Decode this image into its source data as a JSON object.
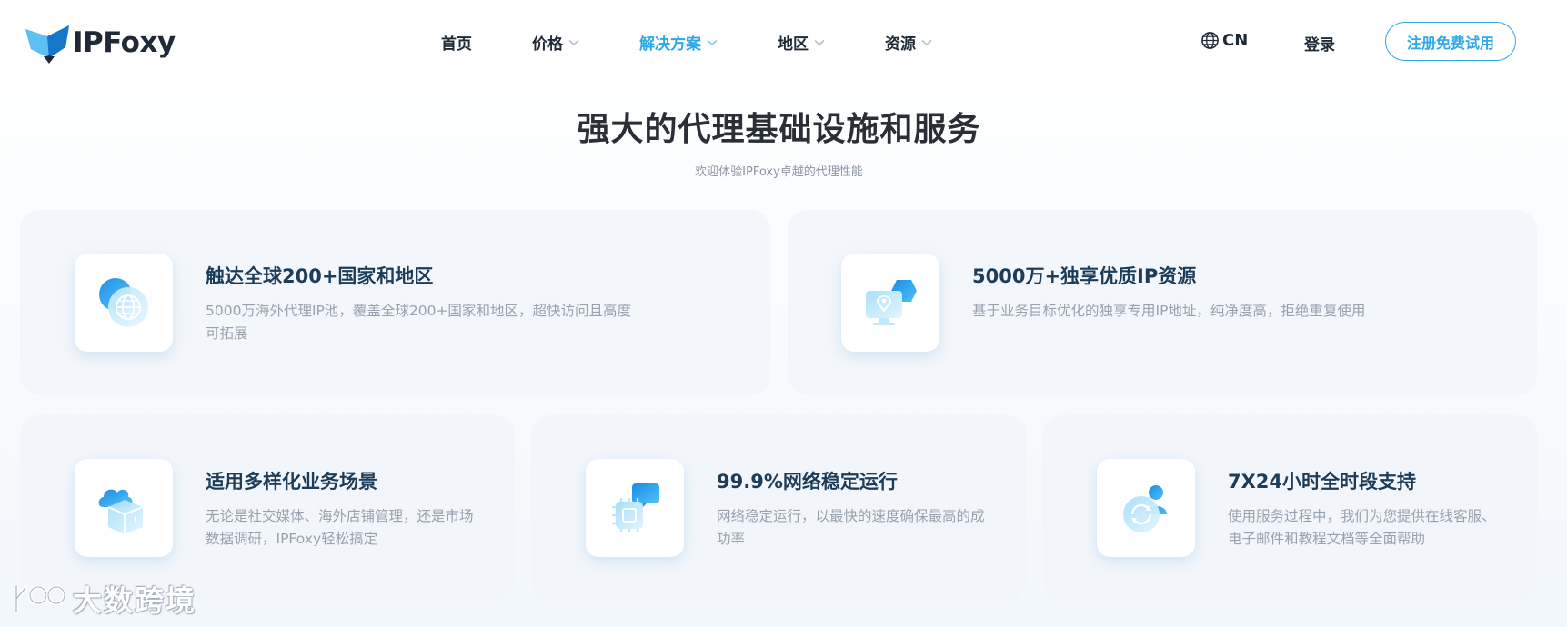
{
  "header": {
    "logo_text": "IPFoxy",
    "nav": [
      {
        "label": "首页",
        "has_dropdown": false,
        "active": false
      },
      {
        "label": "价格",
        "has_dropdown": true,
        "active": false
      },
      {
        "label": "解决方案",
        "has_dropdown": true,
        "active": true
      },
      {
        "label": "地区",
        "has_dropdown": true,
        "active": false
      },
      {
        "label": "资源",
        "has_dropdown": true,
        "active": false
      }
    ],
    "language": "CN",
    "login_label": "登录",
    "signup_label": "注册免费试用"
  },
  "section": {
    "title": "强大的代理基础设施和服务",
    "subtitle": "欢迎体验IPFoxy卓越的代理性能"
  },
  "features": [
    {
      "icon": "globe-icon",
      "title": "触达全球200+国家和地区",
      "desc": "5000万海外代理IP池，覆盖全球200+国家和地区，超快访问且高度可拓展"
    },
    {
      "icon": "location-monitor-icon",
      "title": "5000万+独享优质IP资源",
      "desc": "基于业务目标优化的独享专用IP地址，纯净度高，拒绝重复使用"
    },
    {
      "icon": "cloud-box-icon",
      "title": "适用多样化业务场景",
      "desc": "无论是社交媒体、海外店铺管理，还是市场数据调研，IPFoxy轻松搞定"
    },
    {
      "icon": "chip-chat-icon",
      "title": "99.9%网络稳定运行",
      "desc": "网络稳定运行，以最快的速度确保最高的成功率"
    },
    {
      "icon": "support-agent-icon",
      "title": "7X24小时全时段支持",
      "desc": "使用服务过程中，我们为您提供在线客服、电子邮件和教程文档等全面帮助"
    }
  ],
  "watermark": {
    "text": "大数跨境"
  },
  "colors": {
    "accent": "#2ea8e6",
    "title": "#1c3d5a",
    "text_muted": "#98a2ae"
  }
}
